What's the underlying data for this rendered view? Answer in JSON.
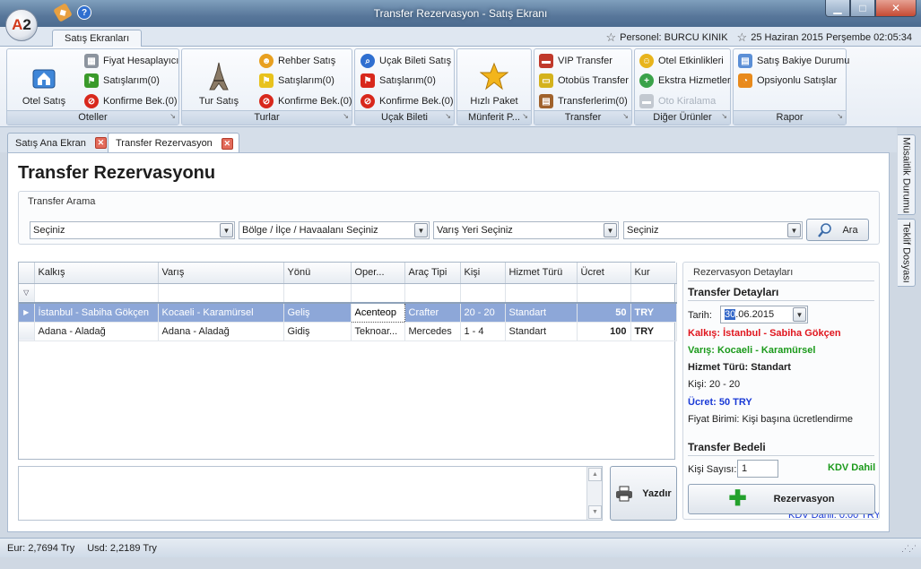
{
  "window": {
    "title": "Transfer Rezervasyon - Satış Ekranı",
    "logo": "A2"
  },
  "ribbon_tab": "Satış Ekranları",
  "user": {
    "personnel": "Personel: BURCU KINIK",
    "datetime": "25 Haziran 2015 Perşembe 02:05:34"
  },
  "ribbon": {
    "oteller": {
      "label": "Oteller",
      "big": "Otel Satış",
      "items": [
        "Fiyat Hesaplayıcı",
        "Satışlarım(0)",
        "Konfirme Bek.(0)"
      ]
    },
    "turlar": {
      "label": "Turlar",
      "big": "Tur Satış",
      "items": [
        "Rehber Satış",
        "Satışlarım(0)",
        "Konfirme Bek.(0)"
      ]
    },
    "ucak": {
      "label": "Uçak Bileti",
      "items": [
        "Uçak Bileti Satış",
        "Satışlarım(0)",
        "Konfirme Bek.(0)"
      ]
    },
    "munferit": {
      "label": "Münferit P...",
      "big": "Hızlı Paket"
    },
    "transfer": {
      "label": "Transfer",
      "items": [
        "VIP Transfer",
        "Otobüs Transfer",
        "Transferlerim(0)"
      ]
    },
    "diger": {
      "label": "Diğer Ürünler",
      "items": [
        "Otel Etkinlikleri",
        "Ekstra Hizmetler",
        "Oto Kiralama"
      ]
    },
    "rapor": {
      "label": "Rapor",
      "items": [
        "Satış Bakiye Durumu",
        "Opsiyonlu Satışlar"
      ]
    }
  },
  "doc_tabs": [
    "Satış Ana Ekran",
    "Transfer Rezervasyon"
  ],
  "side_tabs": [
    "Müsaitlik Durumu",
    "Teklif Dosyası"
  ],
  "page": {
    "title": "Transfer Rezervasyonu",
    "search": {
      "title": "Transfer Arama",
      "combos": [
        "Seçiniz",
        "Bölge / İlçe / Havaalanı Seçiniz",
        "Varış Yeri Seçiniz",
        "Seçiniz"
      ],
      "button": "Ara"
    },
    "grid": {
      "columns": [
        "Kalkış",
        "Varış",
        "Yönü",
        "Oper...",
        "Araç Tipi",
        "Kişi",
        "Hizmet Türü",
        "Ücret",
        "Kur"
      ],
      "rows": [
        [
          "İstanbul - Sabiha Gökçen",
          "Kocaeli - Karamürsel",
          "Geliş",
          "Acenteop",
          "Crafter",
          "20 - 20",
          "Standart",
          "50",
          "TRY"
        ],
        [
          "Adana - Aladağ",
          "Adana - Aladağ",
          "Gidiş",
          "Teknoar...",
          "Mercedes",
          "1 - 4",
          "Standart",
          "100",
          "TRY"
        ]
      ]
    },
    "print_button": "Yazdır",
    "details": {
      "panel_title": "Rezervasyon Detayları",
      "section1": "Transfer Detayları",
      "date_label": "Tarih:",
      "date_day": "30",
      "date_rest": ".06.2015",
      "kalkis": "Kalkış:  İstanbul - Sabiha Gökçen",
      "varis": "Varış:  Kocaeli - Karamürsel",
      "hizmet": "Hizmet Türü:  Standart",
      "kisi": "Kişi:  20 - 20",
      "ucret": "Ücret:  50 TRY",
      "fiyat_birimi": "Fiyat Birimi:  Kişi başına ücretlendirme",
      "section2": "Transfer Bedeli",
      "kisi_sayisi_label": "Kişi Sayısı:",
      "kisi_sayisi": "1",
      "kdv": "KDV Dahil",
      "reserve_button": "Rezervasyon",
      "kdv_total": "KDV Dahil: 0.00 TRY"
    }
  },
  "status": {
    "eur": "Eur: 2,7694 Try",
    "usd": "Usd: 2,2189 Try"
  },
  "colors": {
    "selection": "#8da7d8",
    "red": "#e0161e",
    "green": "#1b9a1b",
    "blue": "#1a3ad6"
  }
}
